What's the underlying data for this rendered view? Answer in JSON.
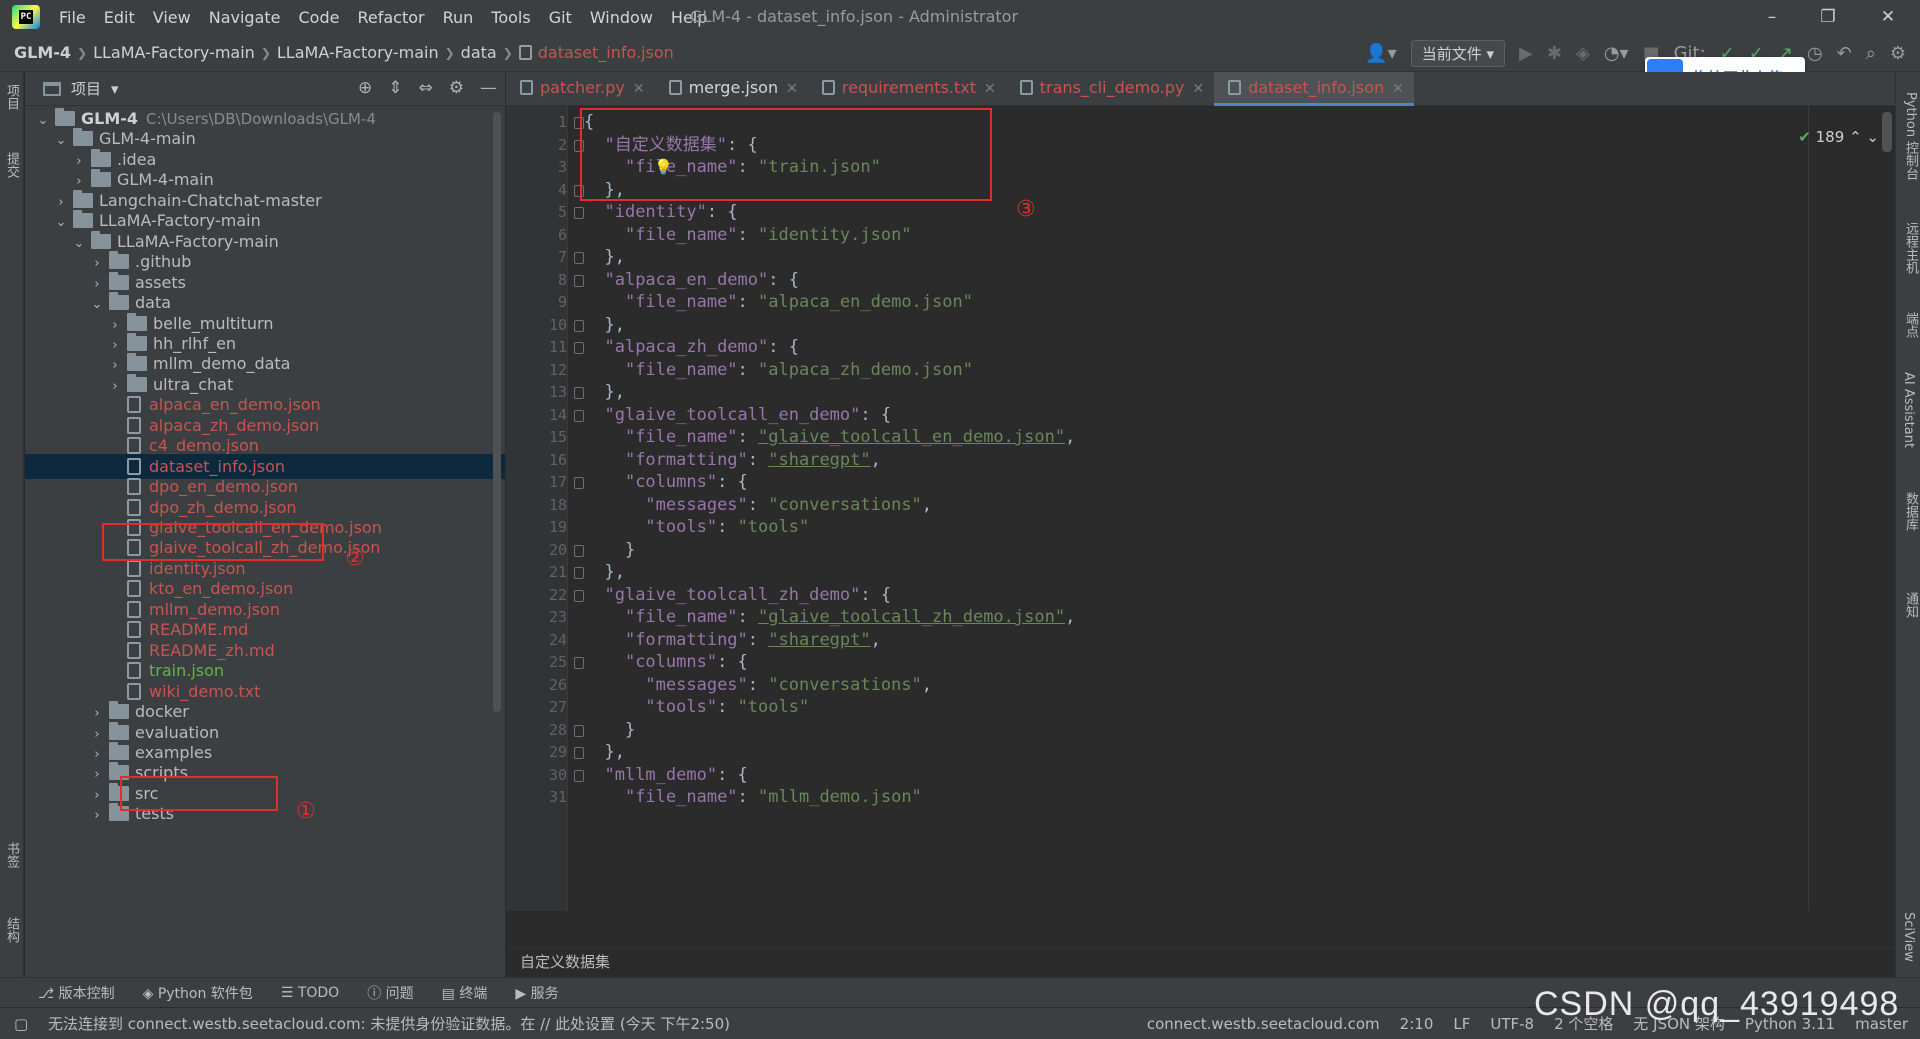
{
  "menubar": {
    "items": [
      "File",
      "Edit",
      "View",
      "Navigate",
      "Code",
      "Refactor",
      "Run",
      "Tools",
      "Git",
      "Window",
      "Help"
    ],
    "title": "GLM-4 - dataset_info.json - Administrator",
    "minimize": "–",
    "restore": "❐",
    "close": "✕"
  },
  "navbar": {
    "crumbs": [
      "GLM-4",
      "LLaMA-Factory-main",
      "LLaMA-Factory-main",
      "data",
      "dataset_info.json"
    ],
    "current_file_btn": "当前文件",
    "git_label": "Git:"
  },
  "upload_btn": "拖拽至此上传",
  "left_strip": {
    "project": "项目",
    "commit": "提交",
    "bookmarks": "书签",
    "structure": "结构"
  },
  "right_strip": {
    "python_console": "Python 控制台",
    "remote_host": "远程主机",
    "endpoints": "端点",
    "ai_assistant": "AI Assistant",
    "database": "数据库",
    "notifications": "通知",
    "sciview": "SciView"
  },
  "project_panel": {
    "title": "项目",
    "tree": [
      {
        "label": "GLM-4",
        "path": "C:\\Users\\DB\\Downloads\\GLM-4",
        "depth": 0,
        "type": "folder",
        "expanded": true,
        "style": "b"
      },
      {
        "label": "GLM-4-main",
        "depth": 1,
        "type": "folder",
        "expanded": true
      },
      {
        "label": ".idea",
        "depth": 2,
        "type": "folder",
        "expanded": false
      },
      {
        "label": "GLM-4-main",
        "depth": 2,
        "type": "folder",
        "expanded": false
      },
      {
        "label": "Langchain-Chatchat-master",
        "depth": 1,
        "type": "folder",
        "expanded": false
      },
      {
        "label": "LLaMA-Factory-main",
        "depth": 1,
        "type": "folder",
        "expanded": true
      },
      {
        "label": "LLaMA-Factory-main",
        "depth": 2,
        "type": "folder",
        "expanded": true
      },
      {
        "label": ".github",
        "depth": 3,
        "type": "folder",
        "expanded": false
      },
      {
        "label": "assets",
        "depth": 3,
        "type": "folder",
        "expanded": false
      },
      {
        "label": "data",
        "depth": 3,
        "type": "folder",
        "expanded": true
      },
      {
        "label": "belle_multiturn",
        "depth": 4,
        "type": "folder",
        "expanded": false
      },
      {
        "label": "hh_rlhf_en",
        "depth": 4,
        "type": "folder",
        "expanded": false
      },
      {
        "label": "mllm_demo_data",
        "depth": 4,
        "type": "folder",
        "expanded": false
      },
      {
        "label": "ultra_chat",
        "depth": 4,
        "type": "folder",
        "expanded": false
      },
      {
        "label": "alpaca_en_demo.json",
        "depth": 4,
        "type": "file",
        "style": "red"
      },
      {
        "label": "alpaca_zh_demo.json",
        "depth": 4,
        "type": "file",
        "style": "red"
      },
      {
        "label": "c4_demo.json",
        "depth": 4,
        "type": "file",
        "style": "red"
      },
      {
        "label": "dataset_info.json",
        "depth": 4,
        "type": "file",
        "style": "red",
        "selected": true
      },
      {
        "label": "dpo_en_demo.json",
        "depth": 4,
        "type": "file",
        "style": "red"
      },
      {
        "label": "dpo_zh_demo.json",
        "depth": 4,
        "type": "file",
        "style": "red"
      },
      {
        "label": "glaive_toolcall_en_demo.json",
        "depth": 4,
        "type": "file",
        "style": "red"
      },
      {
        "label": "glaive_toolcall_zh_demo.json",
        "depth": 4,
        "type": "file",
        "style": "red"
      },
      {
        "label": "identity.json",
        "depth": 4,
        "type": "file",
        "style": "red"
      },
      {
        "label": "kto_en_demo.json",
        "depth": 4,
        "type": "file",
        "style": "red"
      },
      {
        "label": "mllm_demo.json",
        "depth": 4,
        "type": "file",
        "style": "red"
      },
      {
        "label": "README.md",
        "depth": 4,
        "type": "file",
        "style": "red"
      },
      {
        "label": "README_zh.md",
        "depth": 4,
        "type": "file",
        "style": "red"
      },
      {
        "label": "train.json",
        "depth": 4,
        "type": "file",
        "style": "green"
      },
      {
        "label": "wiki_demo.txt",
        "depth": 4,
        "type": "file",
        "style": "red"
      },
      {
        "label": "docker",
        "depth": 3,
        "type": "folder",
        "expanded": false
      },
      {
        "label": "evaluation",
        "depth": 3,
        "type": "folder",
        "expanded": false
      },
      {
        "label": "examples",
        "depth": 3,
        "type": "folder",
        "expanded": false
      },
      {
        "label": "scripts",
        "depth": 3,
        "type": "folder",
        "expanded": false
      },
      {
        "label": "src",
        "depth": 3,
        "type": "folder",
        "expanded": false
      },
      {
        "label": "tests",
        "depth": 3,
        "type": "folder",
        "expanded": false
      }
    ]
  },
  "tabs": [
    {
      "label": "patcher.py",
      "active": false,
      "color": "red"
    },
    {
      "label": "merge.json",
      "active": false,
      "color": "white"
    },
    {
      "label": "requirements.txt",
      "active": false,
      "color": "red"
    },
    {
      "label": "trans_cli_demo.py",
      "active": false,
      "color": "red"
    },
    {
      "label": "dataset_info.json",
      "active": true,
      "color": "red"
    }
  ],
  "editor": {
    "inspection_count": "189",
    "footer_breadcrumb": "自定义数据集",
    "lines": [
      "{",
      "  \"自定义数据集\": {",
      "    \"file_name\": \"train.json\"",
      "  },",
      "  \"identity\": {",
      "    \"file_name\": \"identity.json\"",
      "  },",
      "  \"alpaca_en_demo\": {",
      "    \"file_name\": \"alpaca_en_demo.json\"",
      "  },",
      "  \"alpaca_zh_demo\": {",
      "    \"file_name\": \"alpaca_zh_demo.json\"",
      "  },",
      "  \"glaive_toolcall_en_demo\": {",
      "    \"file_name\": \"glaive_toolcall_en_demo.json\",",
      "    \"formatting\": \"sharegpt\",",
      "    \"columns\": {",
      "      \"messages\": \"conversations\",",
      "      \"tools\": \"tools\"",
      "    }",
      "  },",
      "  \"glaive_toolcall_zh_demo\": {",
      "    \"file_name\": \"glaive_toolcall_zh_demo.json\",",
      "    \"formatting\": \"sharegpt\",",
      "    \"columns\": {",
      "      \"messages\": \"conversations\",",
      "      \"tools\": \"tools\"",
      "    }",
      "  },",
      "  \"mllm_demo\": {",
      "    \"file_name\": \"mllm_demo.json\""
    ]
  },
  "toolwindows": [
    "版本控制",
    "Python 软件包",
    "TODO",
    "问题",
    "终端",
    "服务"
  ],
  "statusbar": {
    "message": "无法连接到 connect.westb.seetacloud.com: 未提供身份验证数据。在 // 此处设置 (今天 下午2:50)",
    "host": "connect.westb.seetacloud.com",
    "position": "2:10",
    "line_sep": "LF",
    "encoding": "UTF-8",
    "indent": "2 个空格",
    "schema": "无 JSON 架构",
    "interpreter": "Python 3.11",
    "branch": "master"
  },
  "annotations": {
    "n1": "①",
    "n2": "②",
    "n3": "③"
  },
  "watermark": "CSDN @qq_43919498"
}
